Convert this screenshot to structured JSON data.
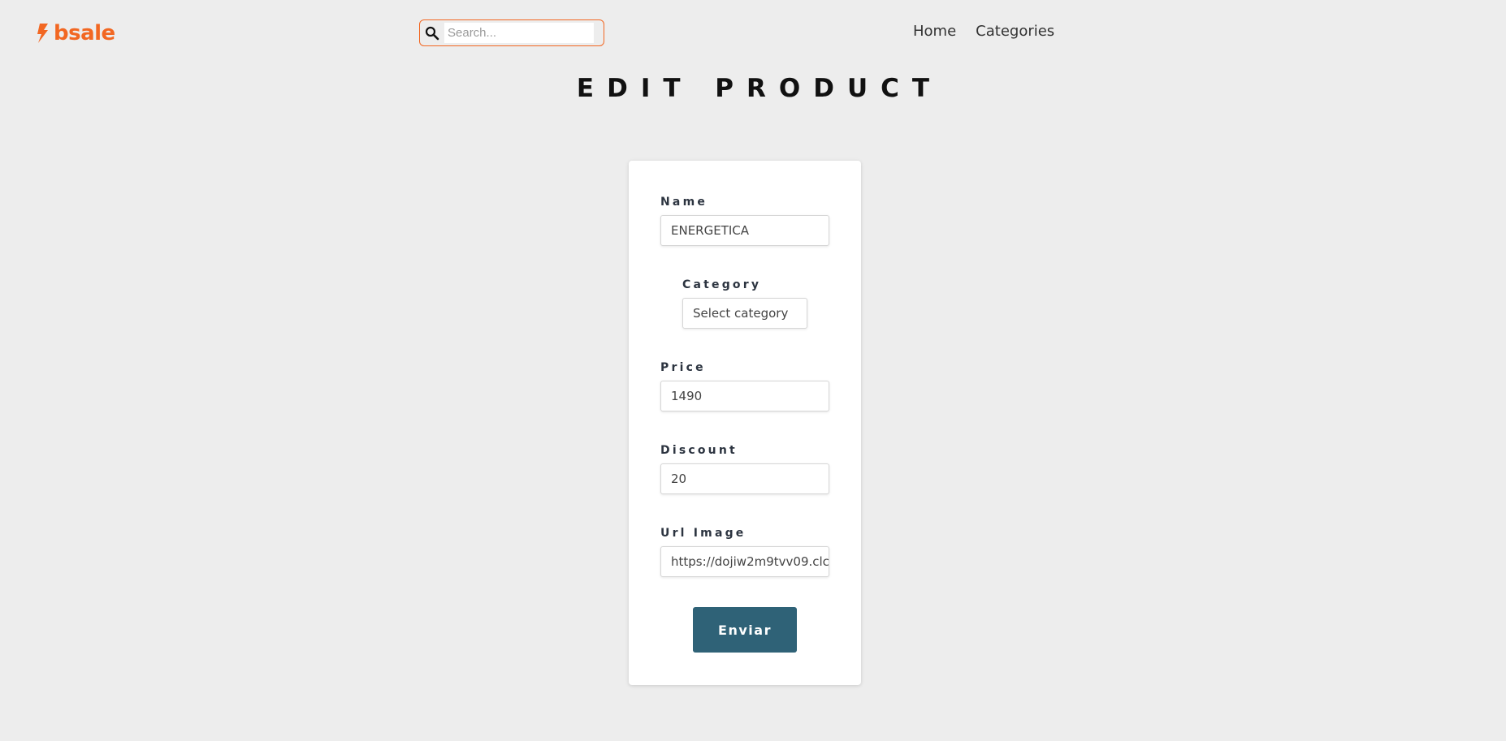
{
  "header": {
    "logo_text": "bsale",
    "brand_color": "#f26722",
    "search": {
      "placeholder": "Search...",
      "value": "",
      "icon": "search-icon"
    },
    "nav": [
      {
        "label": "Home"
      },
      {
        "label": "Categories"
      }
    ]
  },
  "page": {
    "title": "EDIT PRODUCT"
  },
  "form": {
    "name": {
      "label": "Name",
      "value": "ENERGETICA"
    },
    "category": {
      "label": "Category",
      "selected": "Select category"
    },
    "price": {
      "label": "Price",
      "value": "1490"
    },
    "discount": {
      "label": "Discount",
      "value": "20"
    },
    "url_image": {
      "label": "Url Image",
      "value": "https://dojiw2m9tvv09.clc"
    },
    "submit_label": "Enviar",
    "button_color": "#2f6277"
  }
}
